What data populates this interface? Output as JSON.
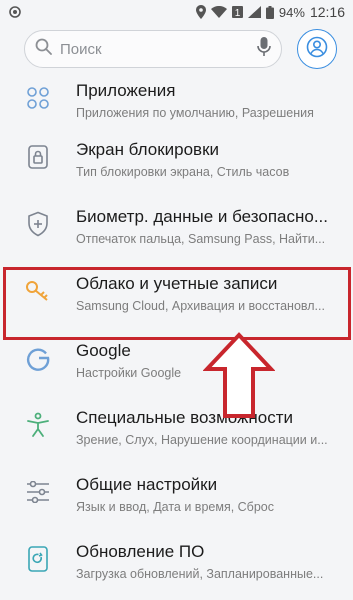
{
  "status_bar": {
    "battery": "94%",
    "time": "12:16",
    "sim_badge": "1"
  },
  "search": {
    "placeholder": "Поиск"
  },
  "settings": {
    "items": [
      {
        "title": "Приложения",
        "subtitle": "Приложения по умолчанию, Разрешения",
        "icon": "apps-grid-icon"
      },
      {
        "title": "Экран блокировки",
        "subtitle": "Тип блокировки экрана, Стиль часов",
        "icon": "lock-icon"
      },
      {
        "title": "Биометр. данные и безопасно...",
        "subtitle": "Отпечаток пальца, Samsung Pass, Найти...",
        "icon": "shield-icon"
      },
      {
        "title": "Облако и учетные записи",
        "subtitle": "Samsung Cloud, Архивация и восстановл...",
        "icon": "key-icon"
      },
      {
        "title": "Google",
        "subtitle": "Настройки Google",
        "icon": "google-icon"
      },
      {
        "title": "Специальные возможности",
        "subtitle": "Зрение, Слух, Нарушение координации и...",
        "icon": "accessibility-icon"
      },
      {
        "title": "Общие настройки",
        "subtitle": "Язык и ввод, Дата и время, Сброс",
        "icon": "sliders-icon"
      },
      {
        "title": "Обновление ПО",
        "subtitle": "Загрузка обновлений, Запланированные...",
        "icon": "software-update-icon"
      }
    ]
  },
  "colors": {
    "accent": "#3a8ee0",
    "highlight": "#c8262d",
    "icon_blue": "#6fa0d6"
  }
}
